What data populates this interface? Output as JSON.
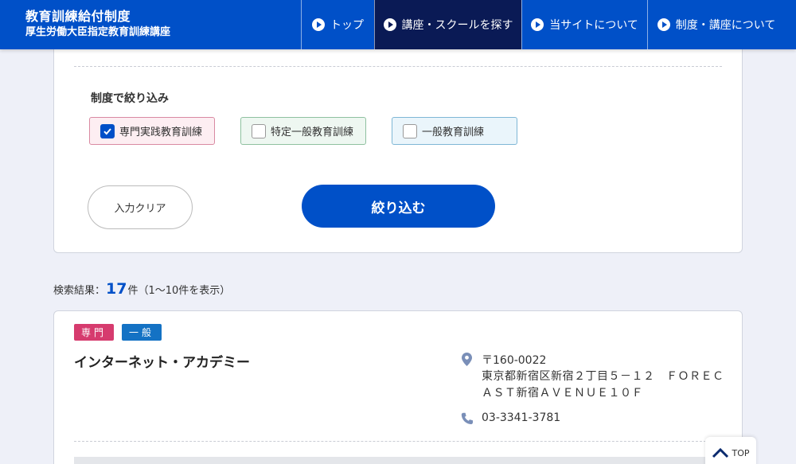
{
  "header": {
    "title": "教育訓練給付制度",
    "subtitle": "厚生労働大臣指定教育訓練講座",
    "nav": [
      {
        "label": "トップ"
      },
      {
        "label": "講座・スクールを探す"
      },
      {
        "label": "当サイトについて"
      },
      {
        "label": "制度・講座について"
      }
    ]
  },
  "filter": {
    "title": "制度で絞り込み",
    "options": [
      {
        "label": "専門実践教育訓練",
        "checked": true
      },
      {
        "label": "特定一般教育訓練",
        "checked": false
      },
      {
        "label": "一般教育訓練",
        "checked": false
      }
    ],
    "clear_label": "入力クリア",
    "submit_label": "絞り込む"
  },
  "results": {
    "prefix": "検索結果：",
    "count": "17",
    "suffix": "件（1〜10件を表示）"
  },
  "card": {
    "tags": [
      "専門",
      "一般"
    ],
    "name": "インターネット・アカデミー",
    "postal": "〒160-0022",
    "address": "東京都新宿区新宿２丁目５－１２　ＦＯＲＥＣＡＳＴ新宿ＡＶＥＮＵＥ１０Ｆ",
    "phone": "03-3341-3781"
  },
  "top_button": {
    "label": "TOP"
  },
  "colors": {
    "primary": "#0050c8",
    "nav_active": "#0a1a55",
    "tag_senmon": "#d63b6e",
    "tag_ippan": "#1472c4"
  }
}
